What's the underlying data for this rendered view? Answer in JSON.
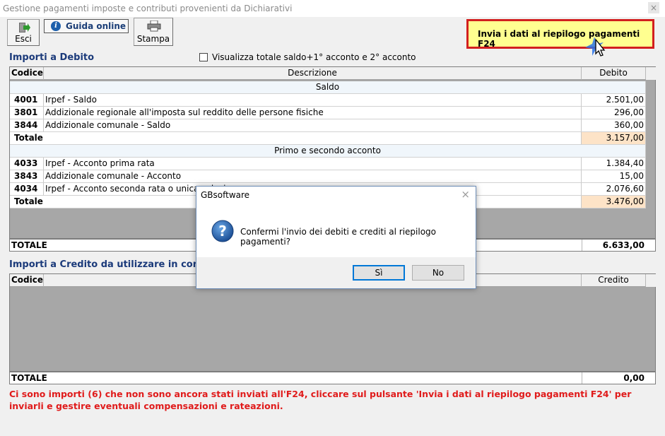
{
  "window": {
    "title": "Gestione pagamenti imposte e contributi provenienti da Dichiarativi",
    "close_glyph": "×"
  },
  "toolbar": {
    "esci_label": "Esci",
    "guida_label": "Guida online",
    "guida_icon_glyph": "i",
    "stampa_label": "Stampa",
    "invia_label": "Invia i dati al riepilogo pagamenti F24"
  },
  "debito": {
    "title": "Importi a Debito",
    "checkbox_label": "Visualizza totale saldo+1° acconto e 2° acconto",
    "columns": {
      "codice": "Codice",
      "descrizione": "Descrizione",
      "debito": "Debito"
    },
    "sections": [
      {
        "title": "Saldo",
        "rows": [
          {
            "code": "4001",
            "desc": "Irpef - Saldo",
            "value": "2.501,00"
          },
          {
            "code": "3801",
            "desc": "Addizionale regionale all'imposta sul reddito delle persone fisiche",
            "value": "296,00"
          },
          {
            "code": "3844",
            "desc": "Addizionale comunale - Saldo",
            "value": "360,00"
          }
        ],
        "total_label": "Totale",
        "total": "3.157,00"
      },
      {
        "title": "Primo e secondo acconto",
        "rows": [
          {
            "code": "4033",
            "desc": "Irpef - Acconto prima rata",
            "value": "1.384,40"
          },
          {
            "code": "3843",
            "desc": "Addizionale comunale - Acconto",
            "value": "15,00"
          },
          {
            "code": "4034",
            "desc": "Irpef - Acconto seconda rata o unica soluzione",
            "value": "2.076,60"
          }
        ],
        "total_label": "Totale",
        "total": "3.476,00"
      }
    ],
    "grand_total_label": "TOTALE",
    "grand_total": "6.633,00"
  },
  "credito": {
    "title": "Importi a Credito da utilizzare in compensazione",
    "columns": {
      "codice": "Codice",
      "credito": "Credito"
    },
    "grand_total_label": "TOTALE",
    "grand_total": "0,00"
  },
  "warning": "Ci sono importi (6) che non sono ancora stati inviati all'F24, cliccare sul pulsante 'Invia i dati al riepilogo pagamenti F24' per inviarli e gestire eventuali compensazioni e rateazioni.",
  "dialog": {
    "title": "GBsoftware",
    "close_glyph": "×",
    "icon_glyph": "?",
    "message": "Confermi l'invio dei debiti e crediti al riepilogo pagamenti?",
    "yes_label": "Sì",
    "no_label": "No"
  },
  "colors": {
    "section_title": "#1b3a7a",
    "warning": "#e01b1b",
    "invia_bg": "#ffff90",
    "invia_border": "#d21f1f",
    "total_cell": "#fde3c7"
  }
}
